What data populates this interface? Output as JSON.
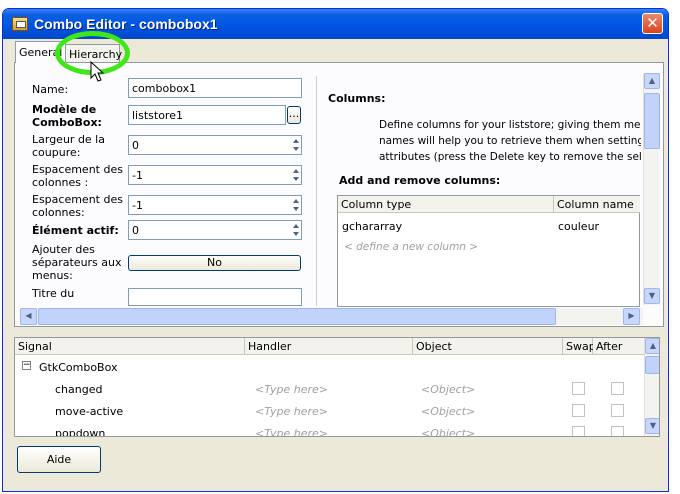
{
  "window": {
    "title": "Combo Editor - combobox1",
    "close_icon": "close-icon"
  },
  "tabs": [
    {
      "label": "General",
      "selected": true
    },
    {
      "label": "Hierarchy",
      "selected": false
    }
  ],
  "form": {
    "name_label": "Name:",
    "name_value": "combobox1",
    "model_label": "Modèle de ComboBox:",
    "model_value": "liststore1",
    "model_browse": "...",
    "wrap_label": "Largeur de la coupure:",
    "wrap_value": "0",
    "col_spacing_label": "Espacement des colonnes :",
    "col_spacing_value": "-1",
    "row_spacing_label": "Espacement des colonnes:",
    "row_spacing_value": "-1",
    "active_label": "Élément actif:",
    "active_value": "0",
    "separators_label": "Ajouter des séparateurs aux menus:",
    "separators_value": "No",
    "titre_label": "Titre du"
  },
  "columns": {
    "title": "Columns:",
    "description": [
      "Define columns for your liststore; giving them meaning",
      "names will help you to retrieve them when setting cell",
      "attributes (press the Delete key to remove the selecte"
    ],
    "add_remove_title": "Add and remove columns:",
    "headers": [
      "Column type",
      "Column name"
    ],
    "rows": [
      {
        "type": "gchararray",
        "name": "couleur"
      }
    ],
    "new_placeholder": "< define a new column >"
  },
  "signals": {
    "headers": [
      "Signal",
      "Handler",
      "Object",
      "Swap",
      "After"
    ],
    "group": "GtkComboBox",
    "rows": [
      {
        "signal": "changed",
        "handler": "<Type here>",
        "object": "<Object>"
      },
      {
        "signal": "move-active",
        "handler": "<Type here>",
        "object": "<Object>"
      },
      {
        "signal": "popdown",
        "handler": "<Type here>",
        "object": "<Object>"
      }
    ]
  },
  "footer": {
    "help_label": "Aide"
  },
  "colors": {
    "titlebar": "#0054e3",
    "highlight_ring": "#3ee61a",
    "window_bg": "#ece9d8"
  }
}
